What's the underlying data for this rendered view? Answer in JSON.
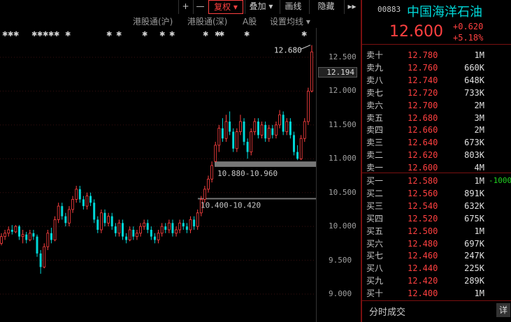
{
  "toolbar": {
    "plus": "+",
    "minus": "—",
    "fuquan": "复权 ▾",
    "diejia": "叠加 ▾",
    "huaxian": "画线",
    "yincang": "隐藏",
    "next": "▸▸"
  },
  "tabs": {
    "hgt_sh": "港股通(沪)",
    "hgt_sz": "港股通(深)",
    "a_share": "A股",
    "ma_setting": "设置均线 ▾"
  },
  "axis": {
    "ticks": [
      "12.500",
      "12.000",
      "11.500",
      "11.000",
      "10.500",
      "10.000",
      "9.500",
      "9.000"
    ],
    "current": "12.194"
  },
  "annotations": {
    "high": "12.680",
    "gap_upper": "10.880-10.960",
    "gap_lower": "10.400-10.420"
  },
  "quote": {
    "code": "00883",
    "name": "中国海洋石油",
    "price": "12.600",
    "change": "+0.620",
    "change_pct": "+5.18%"
  },
  "order_book": {
    "asks": [
      {
        "label": "卖十",
        "price": "12.780",
        "vol": "1M"
      },
      {
        "label": "卖九",
        "price": "12.760",
        "vol": "660K"
      },
      {
        "label": "卖八",
        "price": "12.740",
        "vol": "648K"
      },
      {
        "label": "卖七",
        "price": "12.720",
        "vol": "733K"
      },
      {
        "label": "卖六",
        "price": "12.700",
        "vol": "2M"
      },
      {
        "label": "卖五",
        "price": "12.680",
        "vol": "3M"
      },
      {
        "label": "卖四",
        "price": "12.660",
        "vol": "2M"
      },
      {
        "label": "卖三",
        "price": "12.640",
        "vol": "673K"
      },
      {
        "label": "卖二",
        "price": "12.620",
        "vol": "803K"
      },
      {
        "label": "卖一",
        "price": "12.600",
        "vol": "4M"
      }
    ],
    "bids": [
      {
        "label": "买一",
        "price": "12.580",
        "vol": "1M",
        "chg": "-1000"
      },
      {
        "label": "买二",
        "price": "12.560",
        "vol": "891K"
      },
      {
        "label": "买三",
        "price": "12.540",
        "vol": "632K"
      },
      {
        "label": "买四",
        "price": "12.520",
        "vol": "675K"
      },
      {
        "label": "买五",
        "price": "12.500",
        "vol": "1M"
      },
      {
        "label": "买六",
        "price": "12.480",
        "vol": "697K"
      },
      {
        "label": "买七",
        "price": "12.460",
        "vol": "247K"
      },
      {
        "label": "买八",
        "price": "12.440",
        "vol": "225K"
      },
      {
        "label": "买九",
        "price": "12.420",
        "vol": "289K"
      },
      {
        "label": "买十",
        "price": "12.400",
        "vol": "1M"
      }
    ]
  },
  "trade_panel": {
    "label": "分时成交",
    "detail": "详"
  },
  "colors": {
    "up": "#ff4040",
    "down": "#00d8d8",
    "accent": "#7a1010"
  },
  "chart_data": {
    "type": "candlestick",
    "ylim": [
      8.9,
      12.75
    ],
    "y_ticks": [
      9.0,
      9.5,
      10.0,
      10.5,
      11.0,
      11.5,
      12.0,
      12.5
    ],
    "high_marker": 12.68,
    "gap_zones": [
      [
        10.88,
        10.96
      ],
      [
        10.4,
        10.42
      ]
    ],
    "candles": [
      [
        9.75,
        9.85,
        9.72,
        9.9
      ],
      [
        9.85,
        9.9,
        9.8,
        9.95
      ],
      [
        9.9,
        9.95,
        9.85,
        10.0
      ],
      [
        9.95,
        9.92,
        9.88,
        10.02
      ],
      [
        9.92,
        10.0,
        9.9,
        10.02
      ],
      [
        10.0,
        9.85,
        9.8,
        10.02
      ],
      [
        9.85,
        9.88,
        9.75,
        9.95
      ],
      [
        9.88,
        9.8,
        9.75,
        9.92
      ],
      [
        9.8,
        9.9,
        9.78,
        9.95
      ],
      [
        9.9,
        9.85,
        9.8,
        9.95
      ],
      [
        9.85,
        9.6,
        9.55,
        9.88
      ],
      [
        9.6,
        9.4,
        9.3,
        9.65
      ],
      [
        9.4,
        9.7,
        9.38,
        9.75
      ],
      [
        9.7,
        9.9,
        9.65,
        9.95
      ],
      [
        9.9,
        9.8,
        9.75,
        9.98
      ],
      [
        9.8,
        10.1,
        9.78,
        10.15
      ],
      [
        10.1,
        10.3,
        10.05,
        10.35
      ],
      [
        10.3,
        10.15,
        10.1,
        10.35
      ],
      [
        10.15,
        10.05,
        10.0,
        10.2
      ],
      [
        10.05,
        10.25,
        10.0,
        10.3
      ],
      [
        10.25,
        10.4,
        10.2,
        10.45
      ],
      [
        10.4,
        10.55,
        10.35,
        10.6
      ],
      [
        10.55,
        10.4,
        10.35,
        10.6
      ],
      [
        10.4,
        10.3,
        10.25,
        10.45
      ],
      [
        10.3,
        10.45,
        10.25,
        10.5
      ],
      [
        10.45,
        10.35,
        10.3,
        10.5
      ],
      [
        10.35,
        10.1,
        10.05,
        10.4
      ],
      [
        10.1,
        9.95,
        9.9,
        10.15
      ],
      [
        9.95,
        10.2,
        9.9,
        10.25
      ],
      [
        10.2,
        10.05,
        10.0,
        10.25
      ],
      [
        10.05,
        10.15,
        10.0,
        10.2
      ],
      [
        10.15,
        10.0,
        9.95,
        10.2
      ],
      [
        10.0,
        9.9,
        9.85,
        10.05
      ],
      [
        9.9,
        10.05,
        9.85,
        10.1
      ],
      [
        10.05,
        9.85,
        9.8,
        10.1
      ],
      [
        9.85,
        9.8,
        9.75,
        9.9
      ],
      [
        9.8,
        9.95,
        9.78,
        10.0
      ],
      [
        9.95,
        9.85,
        9.8,
        10.0
      ],
      [
        9.85,
        9.9,
        9.8,
        9.95
      ],
      [
        9.9,
        10.0,
        9.85,
        10.05
      ],
      [
        10.0,
        10.05,
        9.95,
        10.1
      ],
      [
        10.05,
        9.95,
        9.9,
        10.1
      ],
      [
        9.95,
        9.85,
        9.8,
        10.0
      ],
      [
        9.85,
        9.8,
        9.75,
        9.9
      ],
      [
        9.8,
        9.9,
        9.75,
        9.95
      ],
      [
        9.9,
        10.0,
        9.85,
        10.05
      ],
      [
        10.0,
        9.95,
        9.9,
        10.05
      ],
      [
        9.95,
        10.05,
        9.9,
        10.1
      ],
      [
        10.05,
        9.9,
        9.85,
        10.1
      ],
      [
        9.9,
        9.95,
        9.85,
        10.0
      ],
      [
        9.95,
        10.05,
        9.9,
        10.1
      ],
      [
        10.05,
        10.0,
        9.95,
        10.1
      ],
      [
        10.0,
        9.95,
        9.9,
        10.05
      ],
      [
        9.95,
        10.1,
        9.9,
        10.15
      ],
      [
        10.1,
        10.0,
        9.95,
        10.15
      ],
      [
        10.0,
        10.2,
        9.95,
        10.25
      ],
      [
        10.2,
        10.4,
        10.15,
        10.45
      ],
      [
        10.4,
        10.55,
        10.35,
        10.6
      ],
      [
        10.55,
        10.7,
        10.5,
        10.75
      ],
      [
        10.7,
        10.9,
        10.65,
        10.96
      ],
      [
        10.96,
        11.2,
        10.95,
        11.25
      ],
      [
        11.2,
        11.45,
        11.1,
        11.5
      ],
      [
        11.45,
        11.3,
        11.25,
        11.6
      ],
      [
        11.3,
        11.55,
        11.25,
        11.65
      ],
      [
        11.55,
        11.4,
        11.35,
        11.7
      ],
      [
        11.4,
        11.15,
        11.1,
        11.45
      ],
      [
        11.15,
        11.4,
        11.1,
        11.45
      ],
      [
        11.4,
        11.55,
        11.35,
        11.65
      ],
      [
        11.55,
        11.25,
        11.2,
        11.6
      ],
      [
        11.25,
        11.1,
        11.0,
        11.3
      ],
      [
        11.1,
        11.4,
        11.05,
        11.45
      ],
      [
        11.4,
        11.55,
        11.35,
        11.6
      ],
      [
        11.55,
        11.35,
        11.3,
        11.6
      ],
      [
        11.35,
        11.5,
        11.3,
        11.55
      ],
      [
        11.5,
        11.3,
        11.25,
        11.55
      ],
      [
        11.3,
        11.45,
        11.25,
        11.5
      ],
      [
        11.45,
        11.35,
        11.3,
        11.5
      ],
      [
        11.35,
        11.5,
        11.3,
        11.55
      ],
      [
        11.5,
        11.65,
        11.45,
        11.72
      ],
      [
        11.65,
        11.4,
        11.35,
        11.7
      ],
      [
        11.4,
        11.55,
        11.35,
        11.6
      ],
      [
        11.55,
        11.35,
        11.3,
        11.6
      ],
      [
        11.35,
        11.1,
        11.05,
        11.4
      ],
      [
        11.1,
        11.0,
        10.98,
        11.2
      ],
      [
        11.0,
        11.3,
        10.98,
        11.35
      ],
      [
        11.3,
        11.55,
        11.25,
        11.6
      ],
      [
        11.55,
        12.0,
        11.5,
        12.05
      ],
      [
        12.0,
        12.58,
        11.98,
        12.68
      ]
    ]
  }
}
